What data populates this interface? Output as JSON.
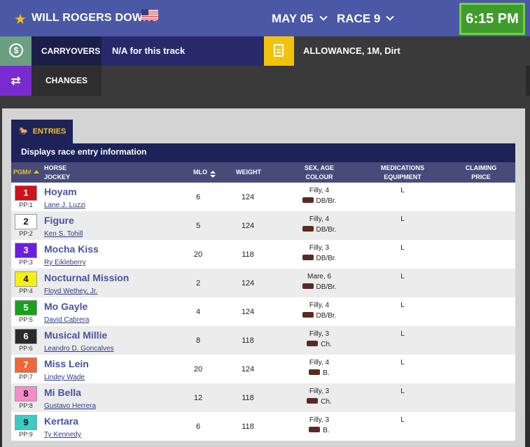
{
  "header": {
    "track_name": "WILL ROGERS DOWNS",
    "date": "MAY 05",
    "race": "RACE 9",
    "post_time": "6:15 PM"
  },
  "carryovers": {
    "label": "CARRYOVERS",
    "value": "N/A for this track"
  },
  "race_info": {
    "value": "ALLOWANCE, 1M, Dirt"
  },
  "changes": {
    "label": "CHANGES"
  },
  "entries": {
    "tab_label": "ENTRIES",
    "description": "Displays race entry information",
    "columns": {
      "pgm": "PGM#",
      "horse": "HORSE",
      "jockey": "JOCKEY",
      "mlo": "MLO",
      "weight": "WEIGHT",
      "sex_age": "SEX, AGE",
      "colour": "COLOUR",
      "medications": "MEDICATIONS",
      "equipment": "EQUIPMENT",
      "claiming": "CLAIMING",
      "price": "PRICE"
    },
    "rows": [
      {
        "pgm": "1",
        "pp": "PP:1",
        "horse": "Hoyam",
        "jockey": "Lane J. Luzzi",
        "mlo": "6",
        "weight": "124",
        "sex_age": "Filly, 4",
        "colour": "DB/Br.",
        "meds": "L",
        "color": "#d0121a",
        "text_color": "#ffffff"
      },
      {
        "pgm": "2",
        "pp": "PP:2",
        "horse": "Figure",
        "jockey": "Ken S. Tohill",
        "mlo": "5",
        "weight": "124",
        "sex_age": "Filly, 4",
        "colour": "DB/Br.",
        "meds": "L",
        "color": "#ffffff",
        "text_color": "#111111"
      },
      {
        "pgm": "3",
        "pp": "PP:3",
        "horse": "Mocha Kiss",
        "jockey": "Ry Eikleberry",
        "mlo": "20",
        "weight": "118",
        "sex_age": "Filly, 3",
        "colour": "DB/Br.",
        "meds": "L",
        "color": "#6a1fe0",
        "text_color": "#ffffff"
      },
      {
        "pgm": "4",
        "pp": "PP:4",
        "horse": "Nocturnal Mission",
        "jockey": "Floyd Wethey, Jr.",
        "mlo": "2",
        "weight": "124",
        "sex_age": "Mare, 6",
        "colour": "DB/Br.",
        "meds": "L",
        "color": "#f5f010",
        "text_color": "#111111"
      },
      {
        "pgm": "5",
        "pp": "PP:5",
        "horse": "Mo Gayle",
        "jockey": "David Cabrera",
        "mlo": "4",
        "weight": "124",
        "sex_age": "Filly, 4",
        "colour": "DB/Br.",
        "meds": "L",
        "color": "#19a01e",
        "text_color": "#ffffff"
      },
      {
        "pgm": "6",
        "pp": "PP:6",
        "horse": "Musical Millie",
        "jockey": "Leandro D. Goncalves",
        "mlo": "8",
        "weight": "118",
        "sex_age": "Filly, 3",
        "colour": "Ch.",
        "meds": "L",
        "color": "#2a2a2a",
        "text_color": "#ffffff"
      },
      {
        "pgm": "7",
        "pp": "PP:7",
        "horse": "Miss Lein",
        "jockey": "Lindey Wade",
        "mlo": "20",
        "weight": "124",
        "sex_age": "Filly, 4",
        "colour": "B.",
        "meds": "L",
        "color": "#f2663a",
        "text_color": "#ffffff"
      },
      {
        "pgm": "8",
        "pp": "PP:8",
        "horse": "Mi Bella",
        "jockey": "Gustavo Herrera",
        "mlo": "12",
        "weight": "118",
        "sex_age": "Filly, 3",
        "colour": "Ch.",
        "meds": "L",
        "color": "#f58cc8",
        "text_color": "#111111"
      },
      {
        "pgm": "9",
        "pp": "PP:9",
        "horse": "Kertara",
        "jockey": "Ty Kennedy",
        "mlo": "6",
        "weight": "118",
        "sex_age": "Filly, 3",
        "colour": "B.",
        "meds": "L",
        "color": "#3ccbc4",
        "text_color": "#111111"
      }
    ]
  },
  "colors": {
    "header_bg": "#4b58a6",
    "time_bg": "#3f9c2c",
    "accent_yellow": "#f0c020",
    "navy": "#1d2358"
  }
}
